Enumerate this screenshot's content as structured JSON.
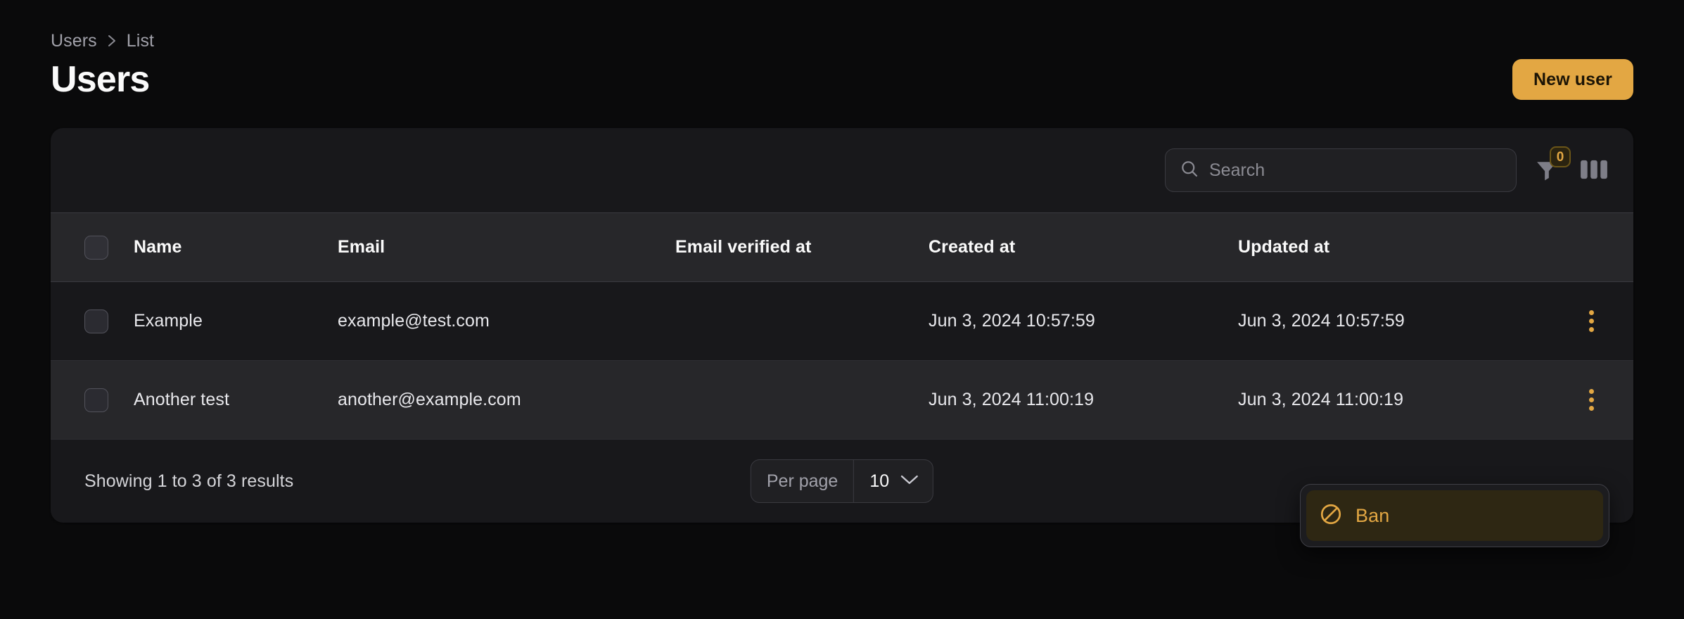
{
  "breadcrumb": {
    "items": [
      {
        "label": "Users"
      },
      {
        "label": "List"
      }
    ]
  },
  "header": {
    "title": "Users",
    "new_user_label": "New user"
  },
  "toolbar": {
    "search_placeholder": "Search",
    "search_value": "",
    "search_icon": "search-icon",
    "filter_icon": "filter-funnel-icon",
    "filter_badge_count": "0",
    "columns_icon": "columns-icon"
  },
  "table": {
    "columns": [
      {
        "key": "select",
        "label": ""
      },
      {
        "key": "name",
        "label": "Name"
      },
      {
        "key": "email",
        "label": "Email"
      },
      {
        "key": "email_verified_at",
        "label": "Email verified at"
      },
      {
        "key": "created_at",
        "label": "Created at"
      },
      {
        "key": "updated_at",
        "label": "Updated at"
      }
    ],
    "rows": [
      {
        "name": "Example",
        "email": "example@test.com",
        "email_verified_at": "",
        "created_at": "Jun 3, 2024 10:57:59",
        "updated_at": "Jun 3, 2024 10:57:59"
      },
      {
        "name": "Another test",
        "email": "another@example.com",
        "email_verified_at": "",
        "created_at": "Jun 3, 2024 11:00:19",
        "updated_at": "Jun 3, 2024 11:00:19"
      }
    ]
  },
  "footer": {
    "showing_text": "Showing 1 to 3 of 3 results",
    "per_page_label": "Per page",
    "per_page_value": "10",
    "chevron_icon": "chevron-down-icon"
  },
  "dropdown": {
    "items": [
      {
        "label": "Ban",
        "icon": "ban-icon",
        "active": true
      }
    ]
  },
  "colors": {
    "accent": "#e3a743",
    "page_background": "#0a0a0b",
    "card_background": "#18181b",
    "row_alt_background": "#27272a",
    "border": "#3a3a40",
    "text_primary": "#fafafa",
    "text_muted": "#a1a1aa"
  }
}
